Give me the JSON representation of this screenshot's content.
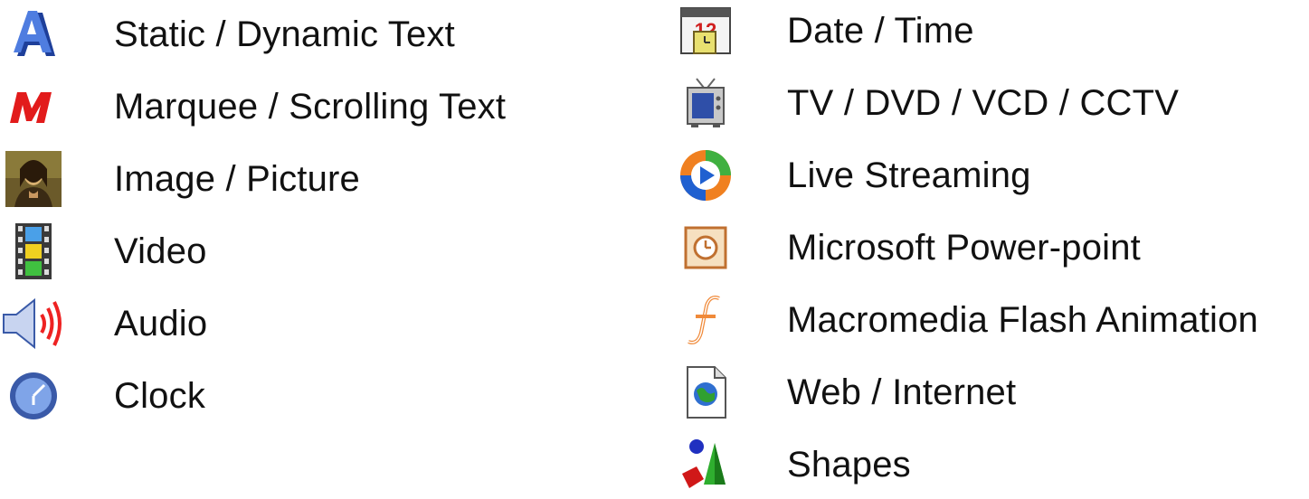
{
  "left_items": [
    {
      "label": "Static / Dynamic Text",
      "icon": "text-a-icon"
    },
    {
      "label": "Marquee / Scrolling Text",
      "icon": "marquee-m-icon"
    },
    {
      "label": "Image / Picture",
      "icon": "picture-icon"
    },
    {
      "label": "Video",
      "icon": "film-strip-icon"
    },
    {
      "label": "Audio",
      "icon": "speaker-icon"
    },
    {
      "label": "Clock",
      "icon": "clock-icon"
    }
  ],
  "right_items": [
    {
      "label": "Date / Time",
      "icon": "calendar-icon",
      "icon_text": "12"
    },
    {
      "label": "TV / DVD / VCD / CCTV",
      "icon": "tv-icon"
    },
    {
      "label": "Live Streaming",
      "icon": "media-player-icon"
    },
    {
      "label": "Microsoft Power-point",
      "icon": "powerpoint-icon"
    },
    {
      "label": "Macromedia Flash Animation",
      "icon": "flash-icon"
    },
    {
      "label": "Web / Internet",
      "icon": "web-page-icon"
    },
    {
      "label": "Shapes",
      "icon": "shapes-icon"
    }
  ],
  "colors": {
    "marquee_red": "#e21b1b",
    "text_blue": "#3a64c8",
    "flash_orange": "#f08a3a",
    "clock_blue": "#4a78c8",
    "shape_green": "#2fae2f",
    "shape_red": "#d01818"
  }
}
